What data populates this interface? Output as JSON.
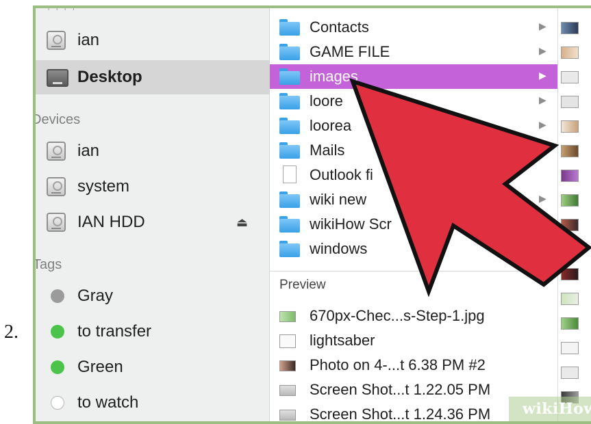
{
  "step_number": "2.",
  "sidebar": {
    "favorites": [
      {
        "label": "ian",
        "icon": "home-disk-icon",
        "selected": false
      },
      {
        "label": "Desktop",
        "icon": "desktop-icon",
        "selected": true
      }
    ],
    "devices_header": "Devices",
    "devices": [
      {
        "label": "ian",
        "icon": "disk-icon"
      },
      {
        "label": "system",
        "icon": "disk-icon"
      },
      {
        "label": "IAN HDD",
        "icon": "disk-icon",
        "eject": "⏏"
      }
    ],
    "tags_header": "Tags",
    "tags": [
      {
        "label": "Gray",
        "color": "#9b9b9b"
      },
      {
        "label": "to transfer",
        "color": "#4cc34b"
      },
      {
        "label": "Green",
        "color": "#4cc34b"
      },
      {
        "label": "to watch",
        "color": "#ffffff"
      }
    ]
  },
  "folders": [
    {
      "label": "Contacts",
      "type": "folder",
      "arrow": "▶"
    },
    {
      "label": "GAME FILE",
      "type": "folder",
      "arrow": "▶"
    },
    {
      "label": "images",
      "type": "folder",
      "arrow": "▶",
      "selected": true
    },
    {
      "label": "loore",
      "type": "folder",
      "arrow": "▶"
    },
    {
      "label": "loorea",
      "type": "folder",
      "arrow": "▶"
    },
    {
      "label": "Mails",
      "type": "folder"
    },
    {
      "label": "Outlook fi",
      "type": "document"
    },
    {
      "label": "wiki new",
      "type": "folder",
      "arrow": "▶"
    },
    {
      "label": "wikiHow Scr",
      "type": "folder"
    },
    {
      "label": "windows",
      "type": "folder"
    }
  ],
  "preview": {
    "header": "Preview",
    "files": [
      {
        "label": "670px-Chec...s-Step-1.jpg",
        "icon": "green"
      },
      {
        "label": "lightsaber",
        "icon": "white"
      },
      {
        "label": "Photo on 4-...t 6.38 PM #2",
        "icon": "dark"
      },
      {
        "label": "Screen Shot...t 1.22.05 PM",
        "icon": "grey"
      },
      {
        "label": "Screen Shot...t 1.24.36 PM",
        "icon": "grey"
      }
    ]
  },
  "accent_color": "#c362d9",
  "pointer_arrow_color": "#e02f3e",
  "watermark": "wikiHow"
}
